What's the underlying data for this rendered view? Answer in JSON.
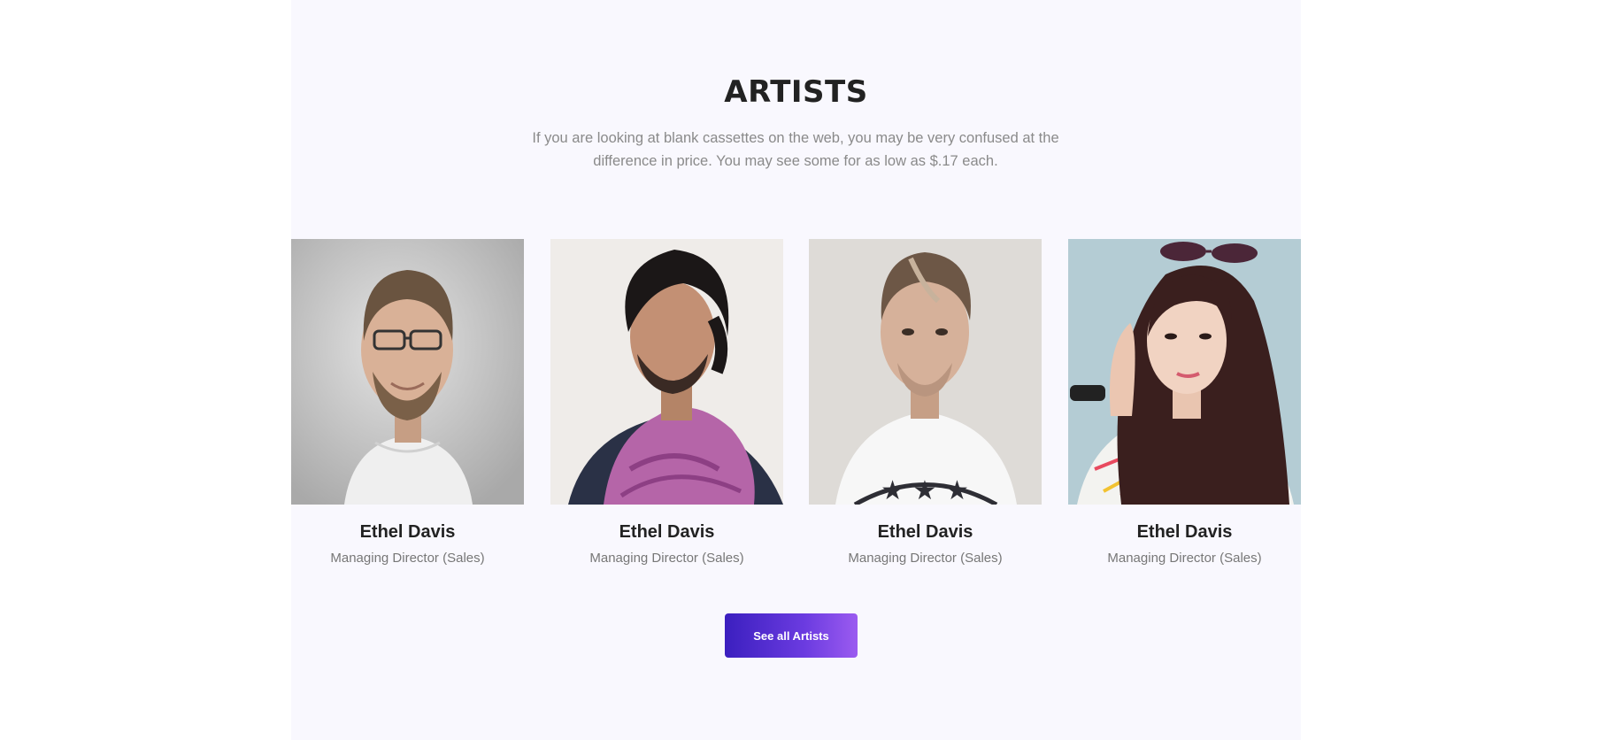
{
  "section": {
    "title": "ARTISTS",
    "subtitle": "If you are looking at blank cassettes on the web, you may be very confused at the difference in price. You may see some for as low as $.17 each."
  },
  "artists": [
    {
      "name": "Ethel Davis",
      "role": "Managing Director (Sales)",
      "photo": "man-with-glasses-white-tshirt"
    },
    {
      "name": "Ethel Davis",
      "role": "Managing Director (Sales)",
      "photo": "man-with-purple-scarf"
    },
    {
      "name": "Ethel Davis",
      "role": "Managing Director (Sales)",
      "photo": "man-white-tshirt-stars"
    },
    {
      "name": "Ethel Davis",
      "role": "Managing Director (Sales)",
      "photo": "woman-with-sunglasses-on-head"
    }
  ],
  "cta": {
    "label": "See all Artists"
  },
  "colors": {
    "section_bg": "#f9f8fe",
    "button_gradient_start": "#3b1fbf",
    "button_gradient_end": "#9b5bf0"
  }
}
